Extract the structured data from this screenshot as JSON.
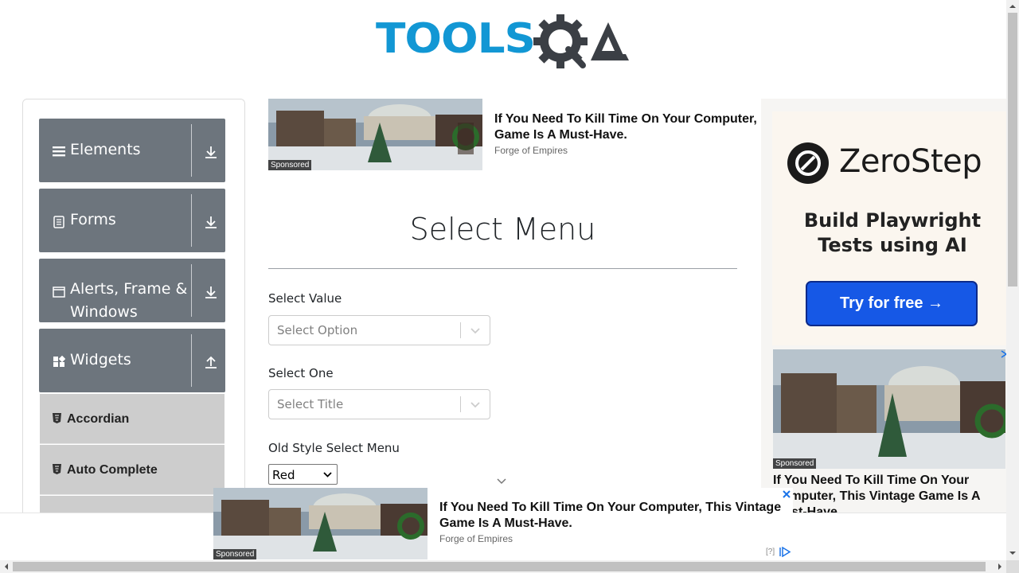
{
  "header": {
    "logo_text": "TOOLSQA"
  },
  "sidebar": {
    "groups": [
      {
        "label": "Elements",
        "icon": "hamburger-icon",
        "arrow": "download-icon"
      },
      {
        "label": "Forms",
        "icon": "document-icon",
        "arrow": "download-icon"
      },
      {
        "label": "Alerts, Frame & Windows",
        "icon": "window-icon",
        "arrow": "download-icon"
      },
      {
        "label": "Widgets",
        "icon": "widgets-icon",
        "arrow": "upload-icon"
      }
    ],
    "items": [
      {
        "label": "Accordian",
        "icon": "html5-icon"
      },
      {
        "label": "Auto Complete",
        "icon": "html5-icon"
      }
    ]
  },
  "top_ad": {
    "title": "If You Need To Kill Time On Your Computer, Game Is A Must-Have.",
    "source": "Forge of Empires",
    "sponsored": "Sponsored"
  },
  "main": {
    "title": "Select Menu",
    "fields": [
      {
        "label": "Select Value",
        "placeholder": "Select Option"
      },
      {
        "label": "Select One",
        "placeholder": "Select Title"
      }
    ],
    "old_style": {
      "label": "Old Style Select Menu",
      "value": "Red"
    }
  },
  "right_ad": {
    "brand": "ZeroStep",
    "tagline": "Build Playwright Tests using AI",
    "cta": "Try for free →",
    "sponsored": "Sponsored",
    "title": "If You Need To Kill Time On Your Computer, This Vintage Game Is A Must-Have."
  },
  "bottom_ad": {
    "title": "If You Need To Kill Time On Your Computer, This Vintage Game Is A Must-Have.",
    "source": "Forge of Empires",
    "sponsored": "Sponsored",
    "info": "[?]"
  },
  "colors": {
    "brand_blue": "#1297d4",
    "logo_dark": "#3b3f45",
    "sidebar_group": "#6d757d",
    "sidebar_item": "#cdcdcd",
    "cta_blue": "#1658e6"
  }
}
